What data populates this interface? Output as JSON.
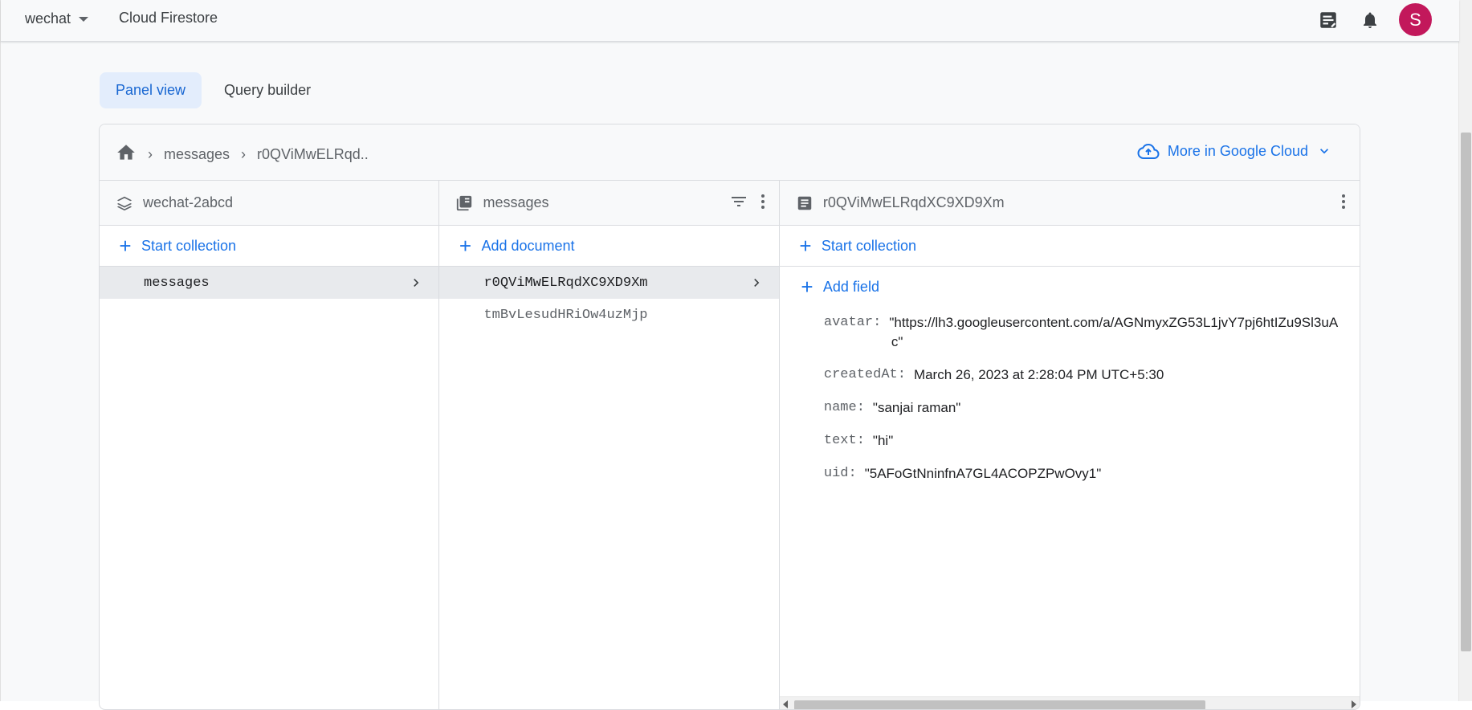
{
  "topbar": {
    "project": "wechat",
    "product": "Cloud Firestore",
    "avatar_initial": "S",
    "icons": [
      "release-notes-icon",
      "bell-icon"
    ]
  },
  "tabs": [
    {
      "label": "Panel view",
      "active": true
    },
    {
      "label": "Query builder",
      "active": false
    }
  ],
  "breadcrumb": {
    "items": [
      "messages",
      "r0QViMwELRqd.."
    ],
    "more_in_cloud": "More in Google Cloud"
  },
  "columns": {
    "root": {
      "title": "wechat-2abcd",
      "action": "Start collection",
      "items": [
        {
          "label": "messages",
          "selected": true
        }
      ]
    },
    "collection": {
      "title": "messages",
      "action": "Add document",
      "items": [
        {
          "label": "r0QViMwELRqdXC9XD9Xm",
          "selected": true
        },
        {
          "label": "tmBvLesudHRiOw4uzMjp",
          "selected": false
        }
      ]
    },
    "document": {
      "title": "r0QViMwELRqdXC9XD9Xm",
      "action": "Start collection",
      "add_field": "Add field",
      "fields": [
        {
          "key": "avatar:",
          "value": "\"https://lh3.googleusercontent.com/a/AGNmyxZG53L1jvY7pj6htIZu9Sl3uA",
          "value_cont": "c\""
        },
        {
          "key": "createdAt:",
          "value": "March 26, 2023 at 2:28:04 PM UTC+5:30"
        },
        {
          "key": "name:",
          "value": "\"sanjai raman\""
        },
        {
          "key": "text:",
          "value": "\"hi\""
        },
        {
          "key": "uid:",
          "value": "\"5AFoGtNninfnA7GL4ACOPZPwOvy1\""
        }
      ]
    }
  },
  "colors": {
    "accent": "#1a73e8",
    "avatar_bg": "#c2185b",
    "tab_active_bg": "#e3edfc",
    "selected_row_bg": "#e8eaed"
  }
}
